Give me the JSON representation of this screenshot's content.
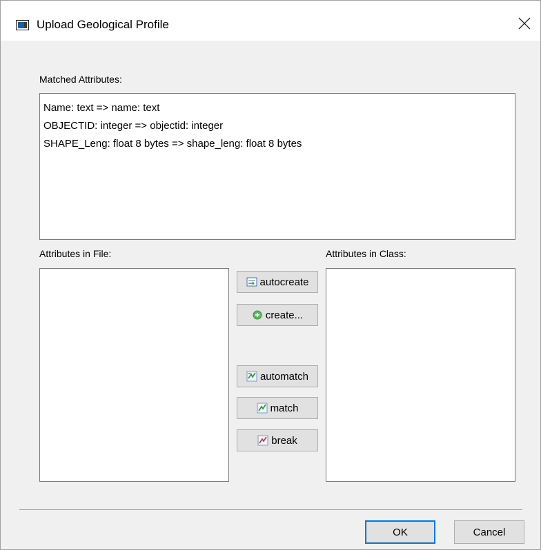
{
  "window": {
    "title": "Upload Geological Profile"
  },
  "matched": {
    "label": "Matched Attributes:",
    "items": [
      "Name: text => name: text",
      "OBJECTID: integer => objectid: integer",
      "SHAPE_Leng: float 8 bytes => shape_leng: float 8 bytes"
    ]
  },
  "file_attrs": {
    "label": "Attributes in File:"
  },
  "class_attrs": {
    "label": "Attributes in Class:"
  },
  "actions": {
    "autocreate": "autocreate",
    "create": "create...",
    "automatch": "automatch",
    "match": "match",
    "break": "break"
  },
  "dialog": {
    "ok": "OK",
    "cancel": "Cancel"
  },
  "colors": {
    "accent": "#0078d7",
    "button_bg": "#e1e1e1",
    "dialog_bg": "#f0f0f0"
  }
}
